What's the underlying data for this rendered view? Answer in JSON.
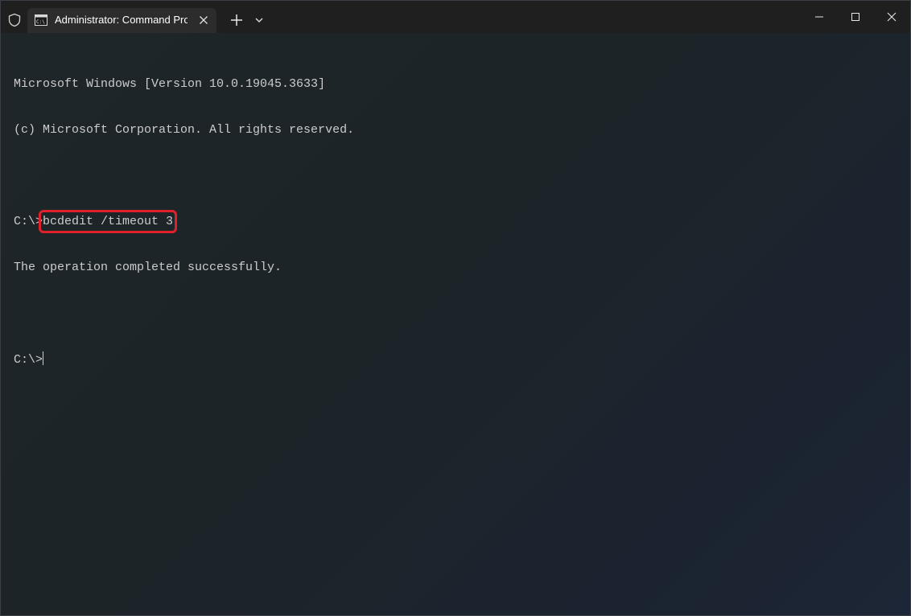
{
  "window": {
    "tab_title": "Administrator: Command Prompt"
  },
  "console": {
    "lines": {
      "banner_version": "Microsoft Windows [Version 10.0.19045.3633]",
      "banner_copyright": "(c) Microsoft Corporation. All rights reserved.",
      "prompt_1": "C:\\>",
      "command_1": "bcdedit /timeout 3",
      "output_1": "The operation completed successfully.",
      "prompt_2": "C:\\>"
    }
  },
  "colors": {
    "highlight_box": "#e0202a",
    "console_text": "#cccccc",
    "titlebar_bg": "#1f1f1f",
    "tab_bg": "#2c2c2c"
  },
  "icons": {
    "admin": "shield-icon",
    "tab": "command-prompt-icon",
    "tab_close": "close-icon",
    "new_tab": "plus-icon",
    "dropdown": "chevron-down-icon",
    "minimize": "minimize-icon",
    "maximize": "maximize-icon",
    "close": "close-icon"
  }
}
